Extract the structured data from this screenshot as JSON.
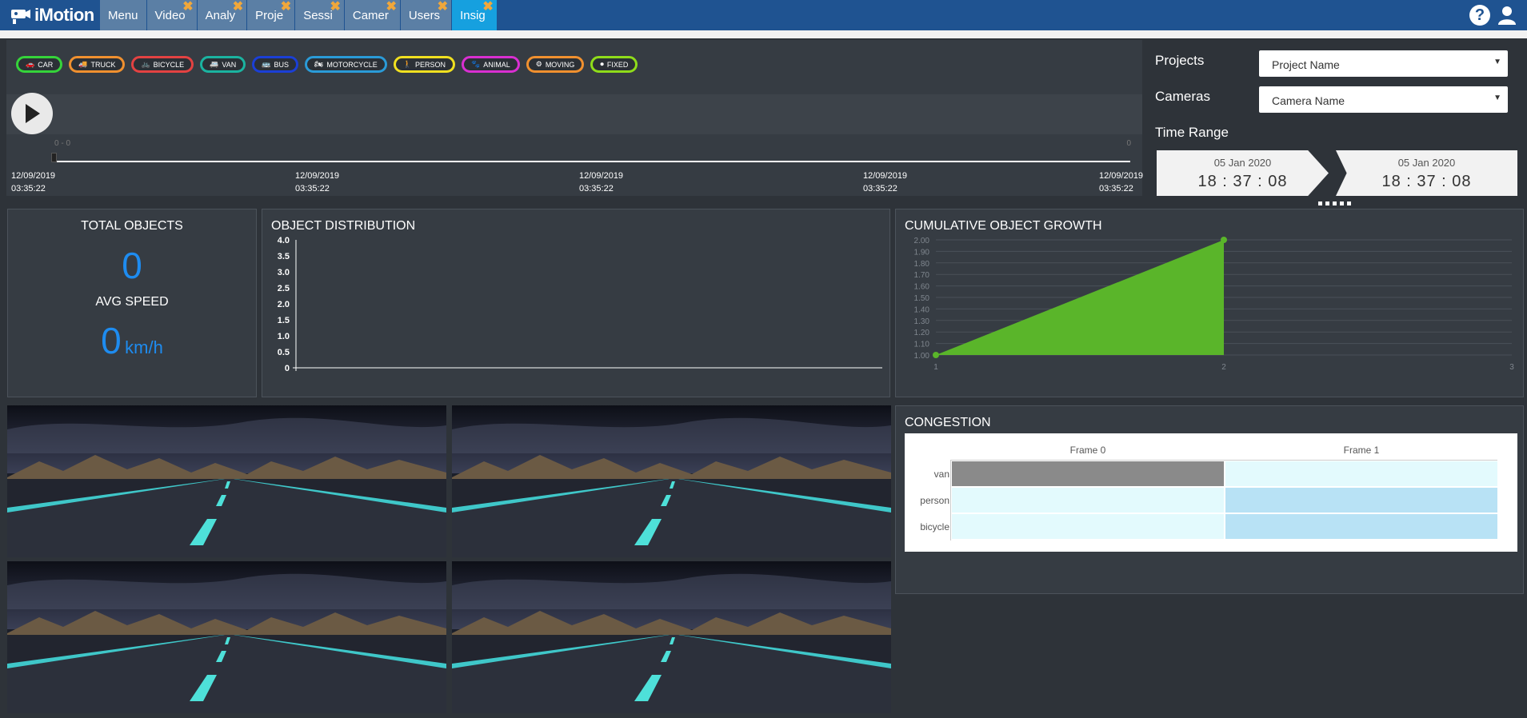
{
  "app": {
    "name": "iMotion"
  },
  "tabs": [
    {
      "label": "Menu",
      "closable": false,
      "active": false
    },
    {
      "label": "Video",
      "closable": true,
      "active": false
    },
    {
      "label": "Analy",
      "closable": true,
      "active": false
    },
    {
      "label": "Proje",
      "closable": true,
      "active": false
    },
    {
      "label": "Sessi",
      "closable": true,
      "active": false
    },
    {
      "label": "Camer",
      "closable": true,
      "active": false
    },
    {
      "label": "Users",
      "closable": true,
      "active": false
    },
    {
      "label": "Insig",
      "closable": true,
      "active": true
    }
  ],
  "tab_close_glyph": "✖",
  "header_icons": {
    "help": "?",
    "user": "user-icon"
  },
  "chips": [
    {
      "label": "CAR",
      "color": "#35d43a",
      "icon": "🚗"
    },
    {
      "label": "TRUCK",
      "color": "#f0902f",
      "icon": "🚚"
    },
    {
      "label": "BICYCLE",
      "color": "#e34242",
      "icon": "🚲"
    },
    {
      "label": "VAN",
      "color": "#1bb3a0",
      "icon": "🚐"
    },
    {
      "label": "BUS",
      "color": "#1b3fd6",
      "icon": "🚌"
    },
    {
      "label": "MOTORCYCLE",
      "color": "#2a9bd8",
      "icon": "🏍"
    },
    {
      "label": "PERSON",
      "color": "#f0e020",
      "icon": "🚶"
    },
    {
      "label": "ANIMAL",
      "color": "#d92fd1",
      "icon": "🐾"
    },
    {
      "label": "MOVING",
      "color": "#f0902f",
      "icon": "⚙"
    },
    {
      "label": "FIXED",
      "color": "#8fdc1a",
      "icon": "⏺"
    }
  ],
  "player": {
    "range_left": "0 - 0",
    "range_right": "0",
    "ticks": [
      {
        "date": "12/09/2019",
        "time": "03:35:22"
      },
      {
        "date": "12/09/2019",
        "time": "03:35:22"
      },
      {
        "date": "12/09/2019",
        "time": "03:35:22"
      },
      {
        "date": "12/09/2019",
        "time": "03:35:22"
      },
      {
        "date": "12/09/2019",
        "time": "03:35:22"
      }
    ]
  },
  "filters": {
    "projects_label": "Projects",
    "projects_value": "Project Name",
    "cameras_label": "Cameras",
    "cameras_value": "Camera Name",
    "time_range_label": "Time Range",
    "start_date": "05 Jan 2020",
    "start_time": "18 : 37 : 08",
    "end_date": "05 Jan 2020",
    "end_time": "18 : 37 : 08"
  },
  "stats": {
    "total_label": "TOTAL OBJECTS",
    "total_value": "0",
    "speed_label": "AVG SPEED",
    "speed_value": "0",
    "speed_unit": "km/h",
    "accent": "#1e8cf0"
  },
  "distribution": {
    "title": "OBJECT DISTRIBUTION"
  },
  "growth": {
    "title": "CUMULATIVE OBJECT GROWTH"
  },
  "congestion": {
    "title": "CONGESTION"
  },
  "chart_data": [
    {
      "type": "bar",
      "title": "OBJECT DISTRIBUTION",
      "categories": [],
      "values": [],
      "yticks": [
        "4.0",
        "3.5",
        "3.0",
        "2.5",
        "2.0",
        "1.5",
        "1.0",
        "0.5",
        "0"
      ],
      "ylim": [
        0,
        4.0
      ]
    },
    {
      "type": "area",
      "title": "CUMULATIVE OBJECT GROWTH",
      "x": [
        1,
        2
      ],
      "values": [
        1.0,
        2.0
      ],
      "xlim": [
        1,
        3
      ],
      "ylim": [
        1.0,
        2.0
      ],
      "xticks": [
        "1",
        "2",
        "3"
      ],
      "yticks": [
        "2.00",
        "1.90",
        "1.80",
        "1.70",
        "1.60",
        "1.50",
        "1.40",
        "1.30",
        "1.20",
        "1.10",
        "1.00"
      ],
      "color": "#5ab52a",
      "grid": true
    },
    {
      "type": "heatmap",
      "title": "CONGESTION",
      "columns": [
        "Frame 0",
        "Frame 1"
      ],
      "rows": [
        "van",
        "person",
        "bicycle"
      ],
      "values": [
        [
          1,
          0
        ],
        [
          0,
          0.5
        ],
        [
          0,
          0.5
        ]
      ],
      "colors": {
        "high": "#8a8a8a",
        "mid": "#b8e2f5",
        "low": "#e3fafd"
      }
    }
  ]
}
